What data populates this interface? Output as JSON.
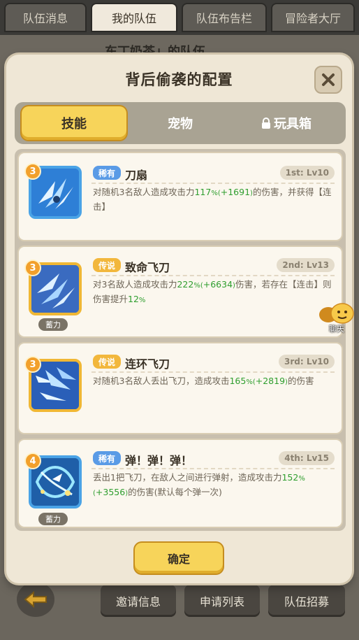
{
  "background": {
    "tabs": [
      "队伍消息",
      "我的队伍",
      "队伍布告栏",
      "冒险者大厅"
    ],
    "active_tab": 1,
    "team_name": "东丁奶茶」的队伍",
    "bottom_buttons": [
      "邀请信息",
      "申请列表",
      "队伍招募"
    ]
  },
  "dialog": {
    "title": "背后偷袭的配置",
    "tabs": [
      "技能",
      "宠物",
      "玩具箱"
    ],
    "active_tab": 0,
    "toybox_locked": true,
    "confirm_label": "确定",
    "skills": [
      {
        "badge": "3",
        "rarity": "稀有",
        "rarity_type": "rare",
        "name": "刀扇",
        "level": "1st: Lv10",
        "charge": "",
        "desc_parts": [
          {
            "t": "对随机3名敌人造成攻击力",
            "c": ""
          },
          {
            "t": "117",
            "c": "g"
          },
          {
            "t": "%(",
            "c": "gs"
          },
          {
            "t": "+1691",
            "c": "g"
          },
          {
            "t": ")",
            "c": "gs"
          },
          {
            "t": "的伤害，并获得【连击】",
            "c": ""
          }
        ]
      },
      {
        "badge": "3",
        "rarity": "传说",
        "rarity_type": "legend",
        "name": "致命飞刀",
        "level": "2nd: Lv13",
        "charge": "蓄力",
        "desc_parts": [
          {
            "t": "对3名敌人造成攻击力",
            "c": ""
          },
          {
            "t": "222",
            "c": "g"
          },
          {
            "t": "%(",
            "c": "gs"
          },
          {
            "t": "+6634",
            "c": "g"
          },
          {
            "t": ")",
            "c": "gs"
          },
          {
            "t": "伤害，若存在【连击】则伤害提升",
            "c": ""
          },
          {
            "t": "12",
            "c": "g"
          },
          {
            "t": "%",
            "c": "gs"
          }
        ]
      },
      {
        "badge": "3",
        "rarity": "传说",
        "rarity_type": "legend",
        "name": "连环飞刀",
        "level": "3rd: Lv10",
        "charge": "",
        "desc_parts": [
          {
            "t": "对随机3名敌人丢出飞刀，造成攻击",
            "c": ""
          },
          {
            "t": "165",
            "c": "g"
          },
          {
            "t": "%(",
            "c": "gs"
          },
          {
            "t": "+2819",
            "c": "g"
          },
          {
            "t": ")",
            "c": "gs"
          },
          {
            "t": "的伤害",
            "c": ""
          }
        ]
      },
      {
        "badge": "4",
        "rarity": "稀有",
        "rarity_type": "rare",
        "name": "弹！弹！弹！",
        "level": "4th: Lv15",
        "charge": "蓄力",
        "desc_parts": [
          {
            "t": "丢出1把飞刀，在敌人之间进行弹射，造成攻击力",
            "c": ""
          },
          {
            "t": "152",
            "c": "g"
          },
          {
            "t": "%(",
            "c": "gs"
          },
          {
            "t": "+3556",
            "c": "g"
          },
          {
            "t": ")",
            "c": "gs"
          },
          {
            "t": "的伤害(默认每个弹一次)",
            "c": ""
          }
        ]
      }
    ]
  },
  "chat": {
    "label": "聊天"
  }
}
